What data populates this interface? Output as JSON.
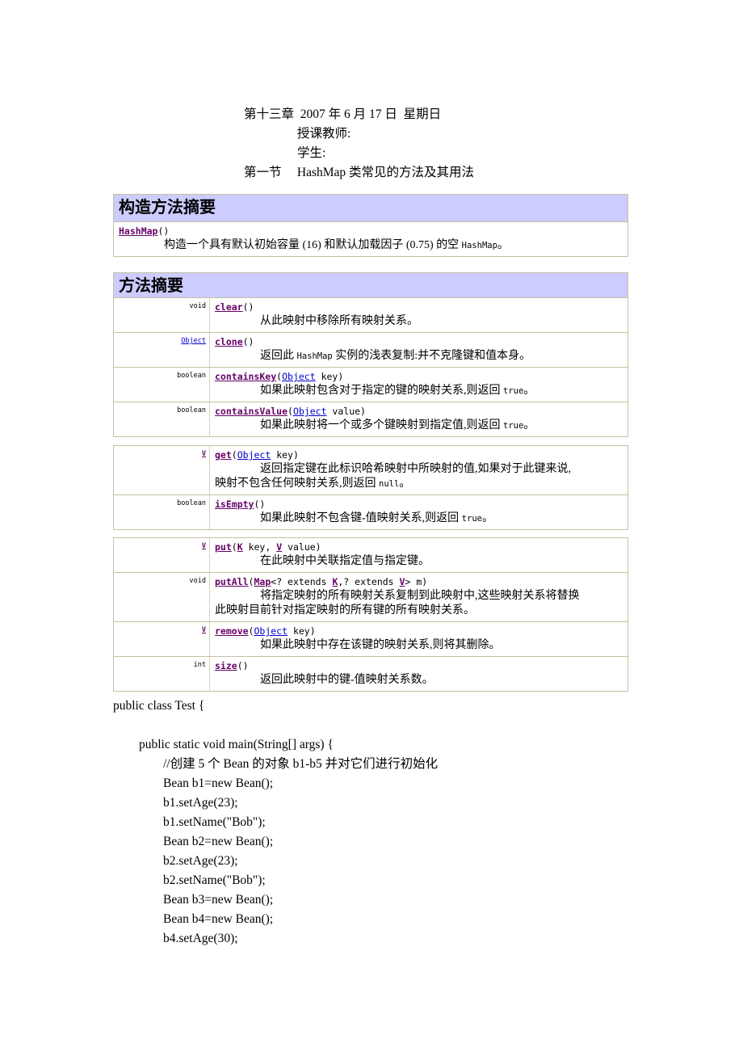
{
  "header": {
    "lines": [
      "第十三章  2007 年 6 月 17 日  星期日",
      "授课教师:",
      "学生:",
      "第一节     HashMap 类常见的方法及其用法"
    ]
  },
  "colors": {
    "banner_bg": "#ccccff",
    "table_border": "#c5c1a5",
    "method_link": "#660066",
    "class_link": "#0000cc"
  },
  "constructor_table": {
    "banner": "构造方法摘要",
    "rows": [
      {
        "name": "HashMap",
        "args": "()",
        "desc_pre": "构造一个具有默认初始容量 (16) 和默认加载因子 (0.75) 的空 ",
        "desc_mono": "HashMap",
        "desc_post": "。"
      }
    ]
  },
  "method_table": {
    "banner": "方法摘要",
    "groups": [
      {
        "rows": [
          {
            "ret": "void",
            "ret_kind": "plain",
            "name": "clear",
            "sig_tail": "()",
            "desc": "从此映射中移除所有映射关系。",
            "desc2": ""
          },
          {
            "ret": "Object",
            "ret_kind": "class",
            "name": "clone",
            "sig_tail": "()",
            "desc_pre": "返回此 ",
            "desc_mono": "HashMap",
            "desc_post": " 实例的浅表复制:并不克隆键和值本身。",
            "desc2": ""
          },
          {
            "ret": "boolean",
            "ret_kind": "plain",
            "name": "containsKey",
            "sig_open": "(",
            "sig_class": "Object",
            "sig_arg": " key)",
            "desc_pre": "如果此映射包含对于指定的键的映射关系,则返回 ",
            "desc_mono": "true",
            "desc_post": "。",
            "desc2": ""
          },
          {
            "ret": "boolean",
            "ret_kind": "plain",
            "name": "containsValue",
            "sig_open": "(",
            "sig_class": "Object",
            "sig_arg": " value)",
            "desc_pre": "如果此映射将一个或多个键映射到指定值,则返回 ",
            "desc_mono": "true",
            "desc_post": "。",
            "desc2": ""
          }
        ]
      },
      {
        "rows": [
          {
            "ret": "V",
            "ret_kind": "type",
            "name": "get",
            "sig_open": "(",
            "sig_class": "Object",
            "sig_arg": " key)",
            "desc_pre": "返回指定键在此标识哈希映射中所映射的值,如果对于此键来说,",
            "desc2_pre": "映射不包含任何映射关系,则返回 ",
            "desc2_mono": "null",
            "desc2_post": "。"
          },
          {
            "ret": "boolean",
            "ret_kind": "plain",
            "name": "isEmpty",
            "sig_tail": "()",
            "desc_pre": "如果此映射不包含键-值映射关系,则返回 ",
            "desc_mono": "true",
            "desc_post": "。",
            "desc2": ""
          }
        ]
      },
      {
        "rows": [
          {
            "ret": "V",
            "ret_kind": "type",
            "name": "put",
            "sig_open": "(",
            "sig_k": "K",
            "sig_mid": " key, ",
            "sig_v": "V",
            "sig_arg": " value)",
            "desc": "在此映射中关联指定值与指定键。",
            "desc2": ""
          },
          {
            "ret": "void",
            "ret_kind": "plain",
            "name": "putAll",
            "sig_open": "(",
            "sig_map": "Map",
            "sig_generic_a": "<? extends ",
            "sig_k": "K",
            "sig_generic_b": ",? extends ",
            "sig_v": "V",
            "sig_arg": "> m)",
            "desc_pre": "将指定映射的所有映射关系复制到此映射中,这些映射关系将替换",
            "desc2_pre": "此映射目前针对指定映射的所有键的所有映射关系。"
          },
          {
            "ret": "V",
            "ret_kind": "type",
            "name": "remove",
            "sig_open": "(",
            "sig_class": "Object",
            "sig_arg": " key)",
            "desc": "如果此映射中存在该键的映射关系,则将其删除。",
            "desc2": ""
          },
          {
            "ret": "int",
            "ret_kind": "plain",
            "name": "size",
            "sig_tail": "()",
            "desc": "返回此映射中的键-值映射关系数。",
            "desc2": ""
          }
        ]
      }
    ]
  },
  "code": {
    "lines": [
      {
        "text": "public class Test {",
        "indent": 0
      },
      {
        "text": "",
        "indent": 0
      },
      {
        "text": "public static void main(String[] args) {",
        "indent": 1
      },
      {
        "text": "//创建 5 个 Bean 的对象 b1-b5 并对它们进行初始化",
        "indent": 2
      },
      {
        "text": "Bean b1=new Bean();",
        "indent": 2
      },
      {
        "text": "b1.setAge(23);",
        "indent": 2
      },
      {
        "text": "b1.setName(\"Bob\");",
        "indent": 2
      },
      {
        "text": "Bean b2=new Bean();",
        "indent": 2
      },
      {
        "text": "b2.setAge(23);",
        "indent": 2
      },
      {
        "text": "b2.setName(\"Bob\");",
        "indent": 2
      },
      {
        "text": "Bean b3=new Bean();",
        "indent": 2
      },
      {
        "text": "Bean b4=new Bean();",
        "indent": 2
      },
      {
        "text": "b4.setAge(30);",
        "indent": 2
      }
    ]
  }
}
